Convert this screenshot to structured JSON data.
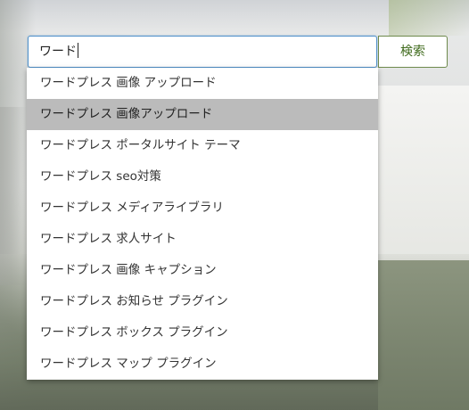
{
  "search": {
    "value": "ワード",
    "button_label": "検索"
  },
  "suggestions": [
    {
      "label": "ワードプレス 画像 アップロード",
      "active": false
    },
    {
      "label": "ワードプレス 画像アップロード",
      "active": true
    },
    {
      "label": "ワードプレス ポータルサイト テーマ",
      "active": false
    },
    {
      "label": "ワードプレス seo対策",
      "active": false
    },
    {
      "label": "ワードプレス メディアライブラリ",
      "active": false
    },
    {
      "label": "ワードプレス 求人サイト",
      "active": false
    },
    {
      "label": "ワードプレス 画像 キャプション",
      "active": false
    },
    {
      "label": "ワードプレス お知らせ プラグイン",
      "active": false
    },
    {
      "label": "ワードプレス ボックス プラグイン",
      "active": false
    },
    {
      "label": "ワードプレス マップ プラグイン",
      "active": false
    }
  ],
  "colors": {
    "input_border": "#4f90c9",
    "button_text": "#3f6a1c",
    "button_border": "#6e8a4c",
    "active_row": "#bbbbbb"
  }
}
